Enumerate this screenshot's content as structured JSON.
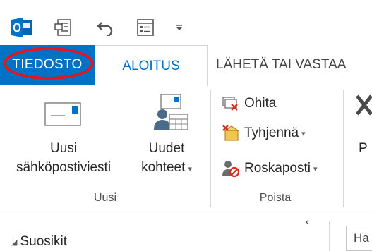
{
  "tabs": {
    "file": "TIEDOSTO",
    "home": "ALOITUS",
    "send_receive": "LÄHETÄ TAI VASTAA"
  },
  "ribbon": {
    "new_email": {
      "line1": "Uusi",
      "line2": "sähköpostiviesti"
    },
    "new_items": {
      "line1": "Uudet",
      "line2": "kohteet"
    },
    "group_new": "Uusi",
    "ignore": "Ohita",
    "clean_up": "Tyhjennä",
    "junk": "Roskaposti",
    "group_delete": "Poista",
    "partial_next": "P"
  },
  "nav": {
    "favorites": "Suosikit",
    "search_partial": "Ha"
  },
  "colors": {
    "accent": "#0072c6",
    "highlight_ring": "#e8131b"
  }
}
